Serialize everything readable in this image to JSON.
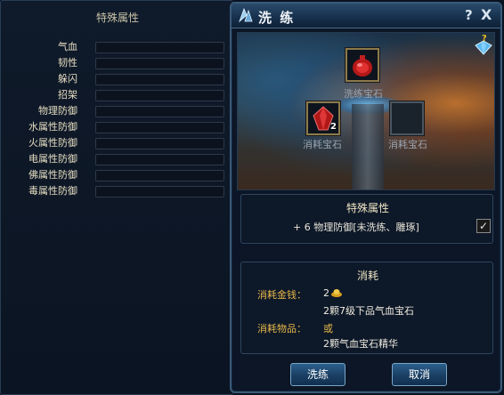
{
  "left": {
    "title": "特殊属性",
    "attributes": [
      "气血",
      "韧性",
      "躲闪",
      "招架",
      "物理防御",
      "水属性防御",
      "火属性防御",
      "电属性防御",
      "佛属性防御",
      "毒属性防御"
    ]
  },
  "window": {
    "title": "洗 练",
    "help": "?",
    "close": "X"
  },
  "slots": {
    "target_caption": "洗练宝石",
    "consume_caption": "消耗宝石",
    "consume_count": "2",
    "empty_caption": "消耗宝石"
  },
  "special": {
    "title": "特殊属性",
    "property": "+ 6  物理防御[未洗练、雕琢]",
    "checkbox_mark": "✓"
  },
  "cost": {
    "title": "消耗",
    "money_label": "消耗金钱：",
    "money_value": "2",
    "item_label": "消耗物品：",
    "option1": "2颗7级下品气血宝石",
    "or": "或",
    "option2": "2颗气血宝石精华"
  },
  "buttons": {
    "confirm": "洗练",
    "cancel": "取消"
  },
  "colors": {
    "accent_gold": "#e7b84a",
    "panel_border": "#3a5a78",
    "button_blue": "#2c5f8c"
  }
}
